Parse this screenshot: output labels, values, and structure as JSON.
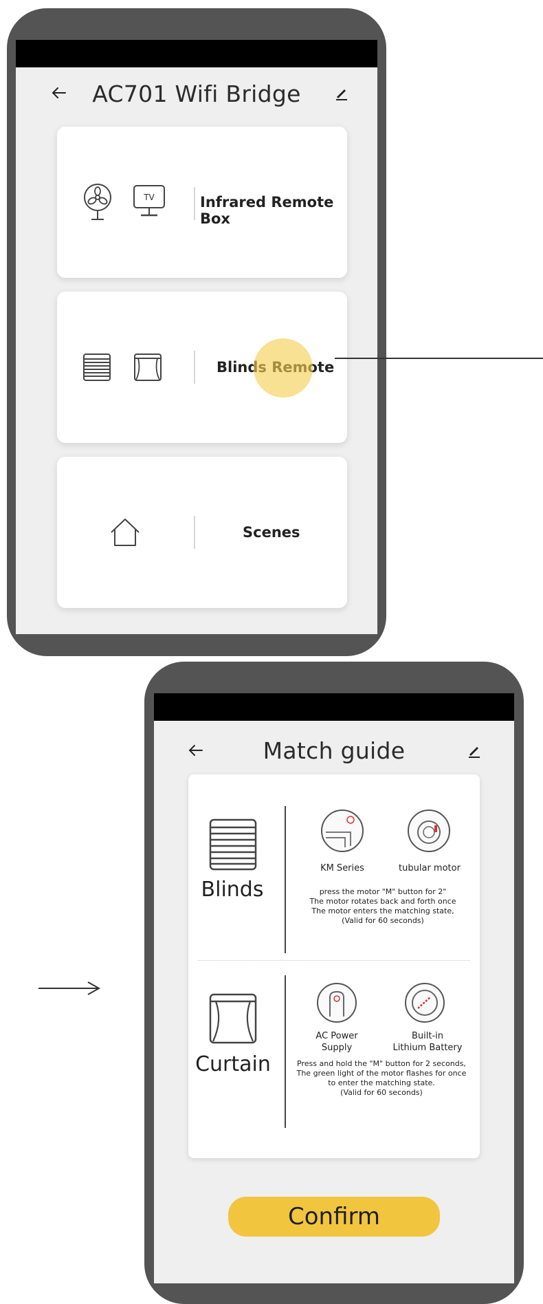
{
  "screen1": {
    "title": "AC701 Wifi Bridge",
    "back_icon": "arrow-left-icon",
    "edit_icon": "pencil-icon",
    "cards": [
      {
        "label": "Infrared Remote Box",
        "icons": [
          "fan-icon",
          "tv-icon"
        ],
        "tv_text": "TV"
      },
      {
        "label": "Blinds Remote",
        "icons": [
          "blinds-icon",
          "curtain-icon"
        ],
        "highlighted": true
      },
      {
        "label": "Scenes",
        "icons": [
          "house-icon"
        ]
      }
    ]
  },
  "screen2": {
    "title": "Match guide",
    "back_icon": "arrow-left-icon",
    "edit_icon": "pencil-icon",
    "blinds": {
      "label": "Blinds",
      "items": [
        "KM Series",
        "tubular motor"
      ],
      "description_lines": [
        "press the motor \"M\" button for 2\"",
        "The motor rotates back and forth once",
        "The motor enters the matching state,",
        "(Valid for 60 seconds)"
      ]
    },
    "curtain": {
      "label": "Curtain",
      "items": [
        {
          "line1": "AC Power",
          "line2": "Supply"
        },
        {
          "line1": "Built-in",
          "line2": "Lithium Battery"
        }
      ],
      "description_lines": [
        "Press and hold the \"M\" button for 2 seconds,",
        "The green light of the motor flashes for once",
        "to enter the matching state.",
        "(Valid for 60 seconds)"
      ]
    },
    "confirm_label": "Confirm"
  },
  "colors": {
    "phone_frame": "#545454",
    "screen_bg": "#efefef",
    "accent_yellow": "#f2c53f",
    "highlight": "#f5ce50"
  }
}
